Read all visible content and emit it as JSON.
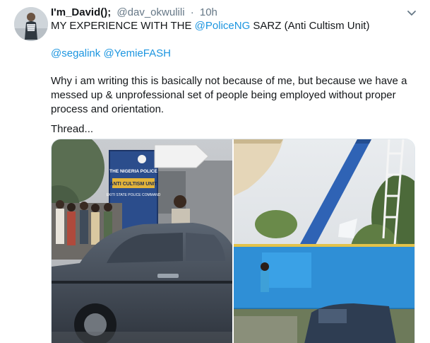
{
  "tweet": {
    "display_name": "I'm_David();",
    "handle": "@dav_okwulili",
    "separator": "·",
    "time": "10h",
    "line1_prefix": "MY EXPERIENCE WITH THE ",
    "line1_mention": "@PoliceNG",
    "line1_suffix": " SARZ (Anti Cultism Unit)",
    "mention_1": "@segalink",
    "mention_2": "@YemieFASH",
    "paragraph": "Why i am writing this is basically not because of me, but because we have a messed up & unprofessional set of people being employed without proper process and orientation.",
    "thread_label": "Thread...",
    "colors": {
      "link": "#1b95e0",
      "muted": "#657786"
    }
  },
  "media": {
    "sign_line1": "THE NIGERIA POLICE",
    "sign_line2": "ANTI CULTISM UNIT",
    "sign_line3": "EKITI STATE POLICE COMMAND"
  }
}
